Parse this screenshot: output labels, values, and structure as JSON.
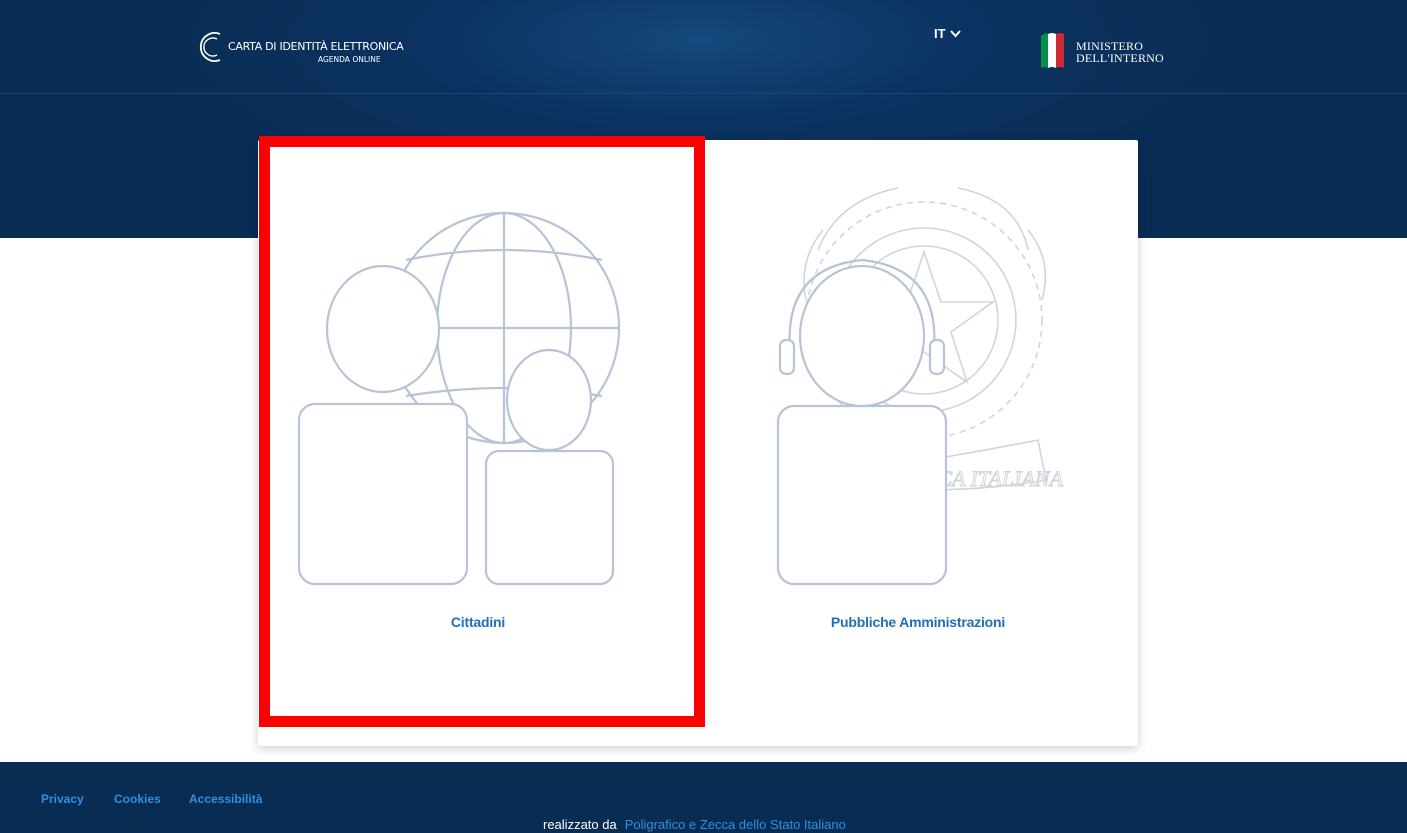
{
  "header": {
    "logo_title": "CARTA DI IDENTITÀ ELETTRONICA",
    "logo_subtitle": "AGENDA ONLINE",
    "language": "IT",
    "ministry_line1": "MINISTERO",
    "ministry_line2": "DELL'INTERNO",
    "colors": {
      "background": "#082c52",
      "flag_green": "#009246",
      "flag_red": "#ce2b37"
    }
  },
  "options": [
    {
      "label": "Cittadini",
      "icon": "citizens-globe-icon"
    },
    {
      "label": "Pubbliche Amministrazioni",
      "icon": "operator-emblem-icon"
    }
  ],
  "footer": {
    "links": [
      "Privacy",
      "Cookies",
      "Accessibilità"
    ],
    "credit_prefix": "realizzato da",
    "credit_link": "Poligrafico e Zecca dello Stato Italiano"
  },
  "colors": {
    "accent": "#1f6fb6",
    "link": "#2f8fe0",
    "highlight": "#ff0000",
    "illustration": "#b7c3d6"
  }
}
